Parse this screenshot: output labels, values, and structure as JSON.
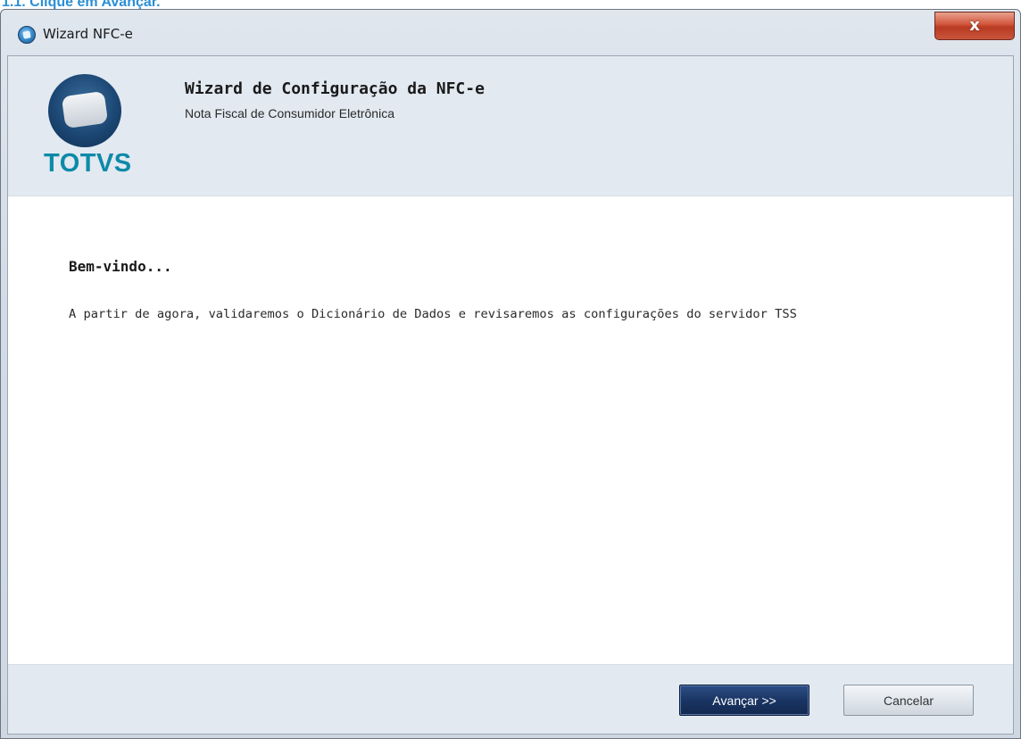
{
  "caption": {
    "text": "1.1. Clique em Avançar."
  },
  "window": {
    "title": "Wizard NFC-e",
    "close_symbol": "x",
    "app_icon": "totvs-app-icon"
  },
  "header": {
    "logo_text": "TOTVS",
    "title": "Wizard de Configuração da NFC-e",
    "subtitle": "Nota Fiscal de Consumidor Eletrônica"
  },
  "content": {
    "heading": "Bem-vindo...",
    "message": "A partir de agora, validaremos o Dicionário de Dados e revisaremos as configurações do servidor TSS"
  },
  "footer": {
    "next_accel": "A",
    "next_rest": "vançar >>",
    "cancel_accel": "C",
    "cancel_rest": "ancelar"
  },
  "colors": {
    "logo_teal": "#0c8aa8",
    "caption_blue": "#2a8fd6",
    "panel_bg": "#e2e9f1",
    "primary_button": "#1a3564"
  }
}
